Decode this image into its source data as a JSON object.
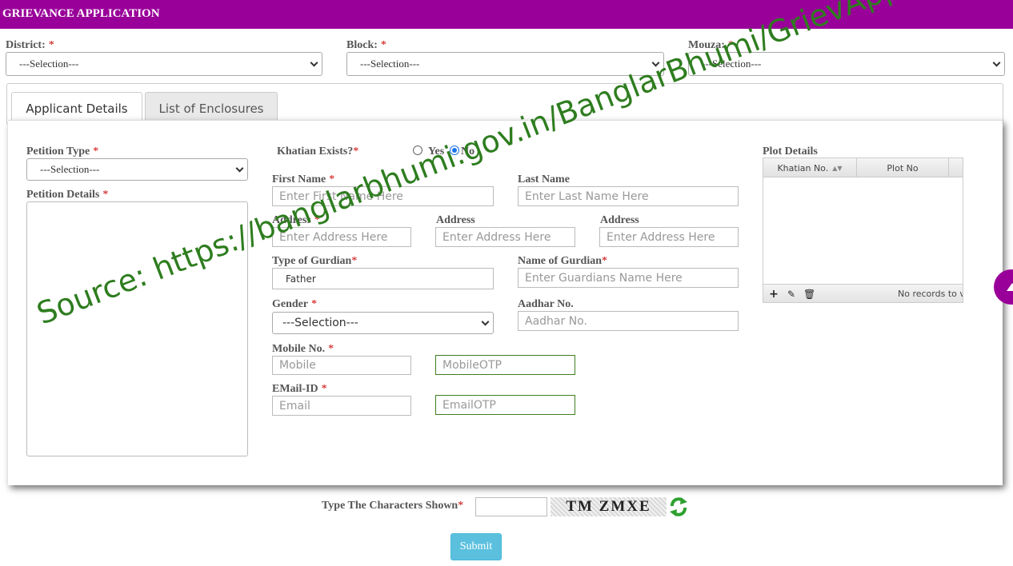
{
  "header": {
    "title": "GRIEVANCE APPLICATION"
  },
  "location": {
    "district": {
      "label": "District:",
      "value": "---Selection---"
    },
    "block": {
      "label": "Block:",
      "value": "---Selection---"
    },
    "mouza": {
      "label": "Mouza:",
      "value": "---Selection---"
    }
  },
  "tabs": [
    {
      "label": "Applicant Details",
      "active": true
    },
    {
      "label": "List of Enclosures",
      "active": false
    }
  ],
  "form": {
    "petition_type": {
      "label": "Petition Type",
      "value": "---Selection---"
    },
    "petition_details": {
      "label": "Petition Details"
    },
    "khatian_exists": {
      "label": "Khatian Exists?",
      "options": [
        "Yes",
        "No"
      ],
      "selected": "No"
    },
    "first_name": {
      "label": "First Name",
      "placeholder": "Enter First Name Here"
    },
    "last_name": {
      "label": "Last Name",
      "placeholder": "Enter Last Name Here"
    },
    "address1": {
      "label": "Address",
      "placeholder": "Enter Address Here"
    },
    "address2": {
      "label": "Address",
      "placeholder": "Enter Address Here"
    },
    "address3": {
      "label": "Address",
      "placeholder": "Enter Address Here"
    },
    "guardian_type": {
      "label": "Type of Gurdian",
      "value": "Father"
    },
    "guardian_name": {
      "label": "Name of Gurdian",
      "placeholder": "Enter Guardians Name Here"
    },
    "gender": {
      "label": "Gender",
      "value": "---Selection---"
    },
    "aadhar": {
      "label": "Aadhar No.",
      "placeholder": "Aadhar No."
    },
    "mobile": {
      "label": "Mobile No.",
      "placeholder": "Mobile",
      "otp_placeholder": "MobileOTP"
    },
    "email": {
      "label": "EMail-ID",
      "placeholder": "Email",
      "otp_placeholder": "EmailOTP"
    }
  },
  "plot_details": {
    "title": "Plot Details",
    "columns": [
      "Khatian No.",
      "Plot No"
    ],
    "empty_text": "No records to v"
  },
  "captcha": {
    "label": "Type The Characters Shown",
    "code": "TM ZMXE"
  },
  "submit_label": "Submit",
  "watermark": "Source: https://banglarbhumi.gov.in/BanglarBhumi/GrievAppViewAction.action",
  "colors": {
    "brand": "#990099",
    "submit": "#5bc0de",
    "watermark": "#2e7d1f",
    "required": "#cc0000"
  }
}
